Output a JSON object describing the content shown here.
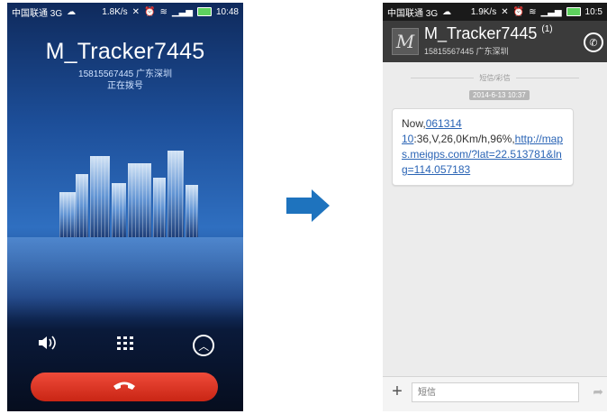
{
  "left_phone": {
    "status": {
      "carrier": "中国联通 3G",
      "speed": "1.8K/s",
      "time": "10:48"
    },
    "caller_name": "M_Tracker7445",
    "caller_number_location": "15815567445 广东深圳",
    "call_status": "正在拨号"
  },
  "right_phone": {
    "status": {
      "carrier": "中国联通 3G",
      "speed": "1.9K/s",
      "time": "10:5"
    },
    "contact_name": "M_Tracker7445",
    "unread_count": "(1)",
    "contact_number_location": "15815567445 广东深圳",
    "separator_label": "短信/彩信",
    "message_date": "2014-6-13 10:37",
    "message": {
      "part1": "Now,",
      "link_date": "061314 10",
      "part2": ":36,V,26,0Km/h,96%,",
      "link_url": "http://maps.meigps.com/?lat=22.513781&lng=114.057183"
    },
    "input_placeholder": "短信"
  },
  "colors": {
    "arrow": "#1e73be",
    "end_call": "#d9321e",
    "link": "#2a64b5"
  }
}
